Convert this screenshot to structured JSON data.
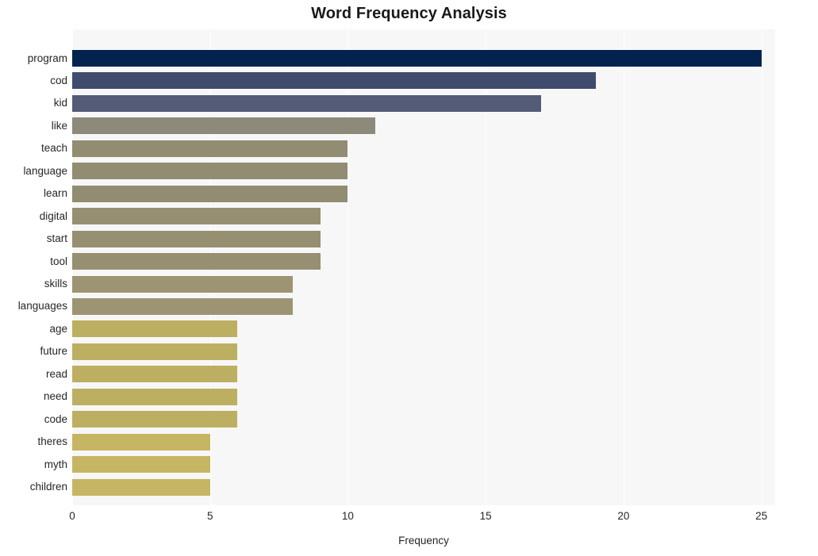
{
  "chart_data": {
    "type": "bar",
    "orientation": "horizontal",
    "title": "Word Frequency Analysis",
    "xlabel": "Frequency",
    "ylabel": "",
    "xlim": [
      0,
      25.5
    ],
    "xticks": [
      0,
      5,
      10,
      15,
      20,
      25
    ],
    "xtick_labels": [
      "0",
      "5",
      "10",
      "15",
      "20",
      "25"
    ],
    "grid": "vertical-white-on-light-background",
    "legend": "none",
    "categories": [
      "program",
      "cod",
      "kid",
      "like",
      "teach",
      "language",
      "learn",
      "digital",
      "start",
      "tool",
      "skills",
      "languages",
      "age",
      "future",
      "read",
      "need",
      "code",
      "theres",
      "myth",
      "children"
    ],
    "values": [
      25,
      19,
      17,
      11,
      10,
      10,
      10,
      9,
      9,
      9,
      8,
      8,
      6,
      6,
      6,
      6,
      6,
      5,
      5,
      5
    ],
    "bar_colors": [
      "#03234f",
      "#3f4c6e",
      "#545b77",
      "#8d8a7a",
      "#918c72",
      "#918c72",
      "#918c72",
      "#968f72",
      "#968f72",
      "#968f72",
      "#9c9473",
      "#9c9473",
      "#bdaf62",
      "#bdaf62",
      "#bdaf62",
      "#bdaf62",
      "#bdaf62",
      "#c6b562",
      "#c6b562",
      "#c6b562"
    ],
    "plot_background": "#f7f7f8",
    "gridline_color": "#ffffff",
    "figure_background": "#ffffff"
  }
}
